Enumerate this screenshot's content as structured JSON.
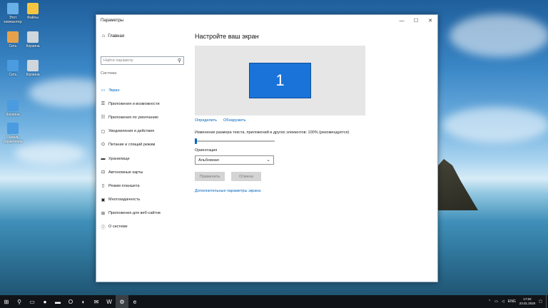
{
  "desktop": {
    "icons": [
      {
        "label": "Этот компьютер",
        "icon": "computer-icon",
        "color": "#6ab0e8"
      },
      {
        "label": "Файлы",
        "icon": "folder-icon",
        "color": "#f5c542"
      },
      {
        "label": "Сеть",
        "icon": "user-icon",
        "color": "#e6a24a"
      },
      {
        "label": "Корзина",
        "icon": "recycle-bin-icon",
        "color": "#cfd6dc"
      },
      {
        "label": "Сеть",
        "icon": "network-icon",
        "color": "#4a9be0"
      },
      {
        "label": "Корзина",
        "icon": "recycle-bin-icon",
        "color": "#cfd6dc"
      },
      {
        "label": "Корзина",
        "icon": "monitor-icon",
        "color": "#4a9be0"
      },
      {
        "label": "Панель управления",
        "icon": "control-panel-icon",
        "color": "#4a9be0"
      }
    ]
  },
  "window": {
    "title": "Параметры",
    "controls": {
      "minimize": "—",
      "maximize": "☐",
      "close": "✕"
    }
  },
  "sidebar": {
    "home_label": "Главная",
    "search_placeholder": "Найти параметр",
    "section_title": "Система",
    "items": [
      {
        "label": "Экран",
        "icon": "monitor-icon",
        "glyph": "▭",
        "active": true
      },
      {
        "label": "Приложения и возможности",
        "icon": "apps-icon",
        "glyph": "☰",
        "active": false
      },
      {
        "label": "Приложения по умолчанию",
        "icon": "default-apps-icon",
        "glyph": "☷",
        "active": false
      },
      {
        "label": "Уведомления и действия",
        "icon": "notifications-icon",
        "glyph": "▢",
        "active": false
      },
      {
        "label": "Питание и спящий режим",
        "icon": "power-icon",
        "glyph": "⏻",
        "active": false
      },
      {
        "label": "Хранилище",
        "icon": "storage-icon",
        "glyph": "▬",
        "active": false
      },
      {
        "label": "Автономные карты",
        "icon": "offline-maps-icon",
        "glyph": "⊡",
        "active": false
      },
      {
        "label": "Режим планшета",
        "icon": "tablet-mode-icon",
        "glyph": "▯",
        "active": false
      },
      {
        "label": "Многозадачность",
        "icon": "multitasking-icon",
        "glyph": "▣",
        "active": false
      },
      {
        "label": "Приложения для веб-сайтов",
        "icon": "web-apps-icon",
        "glyph": "⊞",
        "active": false
      },
      {
        "label": "О системе",
        "icon": "info-icon",
        "glyph": "ⓘ",
        "active": false
      }
    ]
  },
  "main": {
    "heading": "Настройте ваш экран",
    "monitor_number": "1",
    "identify_link": "Определить",
    "detect_link": "Обнаружить",
    "scale_label": "Изменение размера текста, приложений и других элементов: 100% (рекомендуется)",
    "scale_value_percent": 100,
    "orientation_label": "Ориентация",
    "orientation_value": "Альбомная",
    "apply_button": "Применить",
    "cancel_button": "Отмена",
    "advanced_link": "Дополнительные параметры экрана"
  },
  "taskbar": {
    "items": [
      {
        "icon": "windows-start-icon",
        "glyph": "⊞"
      },
      {
        "icon": "search-icon",
        "glyph": "⚲"
      },
      {
        "icon": "task-view-icon",
        "glyph": "▭"
      },
      {
        "icon": "firefox-icon",
        "glyph": "●"
      },
      {
        "icon": "folder-icon",
        "glyph": "▬"
      },
      {
        "icon": "opera-icon",
        "glyph": "O"
      },
      {
        "icon": "cortana-icon",
        "glyph": "◐"
      },
      {
        "icon": "mail-icon",
        "glyph": "✉"
      },
      {
        "icon": "word-icon",
        "glyph": "W"
      },
      {
        "icon": "settings-icon",
        "glyph": "⚙"
      },
      {
        "icon": "edge-icon",
        "glyph": "e"
      }
    ],
    "language": "ENG",
    "time": "17:02",
    "date": "23.01.2020"
  },
  "colors": {
    "accent": "#0067c0",
    "monitor": "#1a73d9",
    "taskbar": "#101418"
  }
}
